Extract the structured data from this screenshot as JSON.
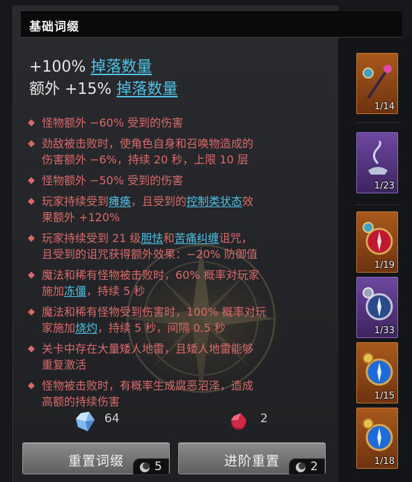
{
  "header": {
    "title": "基础词缀"
  },
  "summary": {
    "line1": {
      "prefix": "+100% ",
      "keyword": "掉落数量"
    },
    "line2": {
      "prefix": "额外 +15% ",
      "keyword": "掉落数量"
    }
  },
  "affixes": [
    {
      "lines": [
        [
          "怪物额外 −60% 受到的伤害"
        ]
      ]
    },
    {
      "lines": [
        [
          "劲敌被击败时，使角色自身和召唤物造成的"
        ],
        [
          "伤害额外 −6%，持续 20 秒，上限 10 层"
        ]
      ]
    },
    {
      "lines": [
        [
          "怪物额外 −50% 受到的伤害"
        ]
      ]
    },
    {
      "parts": {
        "a": "玩家持续受到",
        "kw1": "瘫痪",
        "b": "，且受到的",
        "kw2": "控制类状态",
        "c": "效",
        "line2": "果额外 +120%"
      }
    },
    {
      "parts": {
        "a": "玩家持续受到 21 级",
        "kw1": "胆怯",
        "b": "和",
        "kw2": "苦痛纠缠",
        "c": "诅咒，",
        "line2": "且受到的诅咒获得额外效果：−20% 防御值"
      }
    },
    {
      "parts": {
        "a": "魔法和稀有怪物被击败时，60% 概率对玩家",
        "line2a": "施加",
        "kw1": "冻僵",
        "line2b": "，持续 5 秒"
      }
    },
    {
      "parts": {
        "a": "魔法和稀有怪物受到伤害时，100% 概率对玩",
        "line2a": "家施加",
        "kw1": "烧灼",
        "line2b": "，持续 5 秒，间隔 0.5 秒"
      }
    },
    {
      "lines": [
        [
          "关卡中存在大量矮人地雷，且矮人地雷能够"
        ],
        [
          "重复激活"
        ]
      ]
    },
    {
      "lines": [
        [
          "怪物被击败时，有概率生成腐恶沼泽，造成"
        ],
        [
          "高额的持续伤害"
        ]
      ]
    }
  ],
  "resources": {
    "crystal_count": "64",
    "ruby_count": "2"
  },
  "buttons": {
    "reset": {
      "label": "重置词缀",
      "cost": "5"
    },
    "advance": {
      "label": "进阶重置",
      "cost": "2"
    }
  },
  "inventory": [
    {
      "count": "1/14",
      "rarity": "orange",
      "icon": "staff-icon"
    },
    {
      "count": "1/23",
      "rarity": "purple",
      "icon": "genie-lamp-icon"
    },
    {
      "count": "1/19",
      "rarity": "orange",
      "icon": "red-compass-icon"
    },
    {
      "count": "1/33",
      "rarity": "purple",
      "icon": "silver-compass-icon"
    },
    {
      "count": "1/15",
      "rarity": "orange",
      "icon": "blue-compass-icon"
    },
    {
      "count": "1/18",
      "rarity": "orange",
      "icon": "blue-compass-icon"
    }
  ],
  "colors": {
    "affix_red": "#d96a6a",
    "keyword_blue": "#4fc3e8",
    "orange_rarity": "#a8591c",
    "purple_rarity": "#6d47a0"
  }
}
